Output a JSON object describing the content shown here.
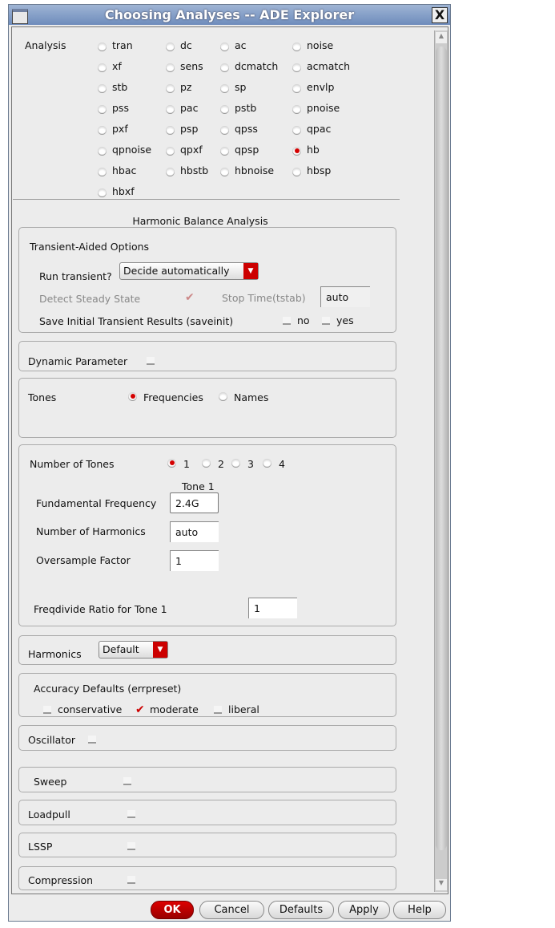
{
  "window": {
    "title": "Choosing Analyses -- ADE Explorer",
    "close": "X"
  },
  "analysis": {
    "label": "Analysis",
    "selected": "hb",
    "options": [
      "tran",
      "dc",
      "ac",
      "noise",
      "xf",
      "sens",
      "dcmatch",
      "acmatch",
      "stb",
      "pz",
      "sp",
      "envlp",
      "pss",
      "pac",
      "pstb",
      "pnoise",
      "pxf",
      "psp",
      "qpss",
      "qpac",
      "qpnoise",
      "qpxf",
      "qpsp",
      "hb",
      "hbac",
      "hbstb",
      "hbnoise",
      "hbsp",
      "hbxf"
    ]
  },
  "section_title": "Harmonic Balance Analysis",
  "transient": {
    "title": "Transient-Aided Options",
    "run_label": "Run transient?",
    "run_value": "Decide automatically",
    "detect_label": "Detect Steady State",
    "stop_label": "Stop Time(tstab)",
    "stop_value": "auto",
    "saveinit_label": "Save Initial Transient Results (saveinit)",
    "no": "no",
    "yes": "yes"
  },
  "dynamic": {
    "label": "Dynamic Parameter"
  },
  "tones": {
    "label": "Tones",
    "frequencies": "Frequencies",
    "names": "Names"
  },
  "num_tones": {
    "label": "Number of Tones",
    "options": [
      "1",
      "2",
      "3",
      "4"
    ],
    "tone_header": "Tone 1",
    "fund_label": "Fundamental Frequency",
    "fund_value": "2.4G",
    "harm_label": "Number of Harmonics",
    "harm_value": "auto",
    "over_label": "Oversample Factor",
    "over_value": "1",
    "freqdiv_label": "Freqdivide Ratio for Tone 1",
    "freqdiv_value": "1"
  },
  "harmonics": {
    "label": "Harmonics",
    "value": "Default"
  },
  "accuracy": {
    "label": "Accuracy Defaults (errpreset)",
    "conservative": "conservative",
    "moderate": "moderate",
    "liberal": "liberal"
  },
  "oscillator": {
    "label": "Oscillator"
  },
  "sweep": {
    "label": "Sweep"
  },
  "loadpull": {
    "label": "Loadpull"
  },
  "lssp": {
    "label": "LSSP"
  },
  "compression": {
    "label": "Compression"
  },
  "buttons": {
    "ok": "OK",
    "cancel": "Cancel",
    "defaults": "Defaults",
    "apply": "Apply",
    "help": "Help"
  }
}
